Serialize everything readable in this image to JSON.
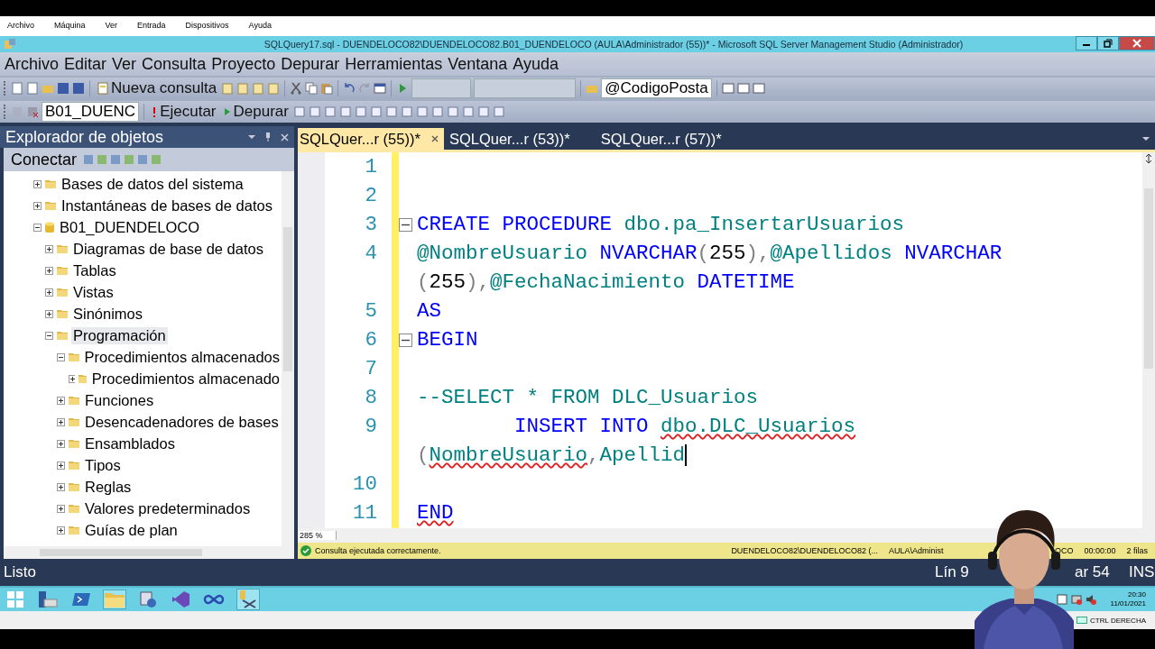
{
  "vm_menu": [
    "Archivo",
    "Máquina",
    "Ver",
    "Entrada",
    "Dispositivos",
    "Ayuda"
  ],
  "window": {
    "title": "SQLQuery17.sql - DUENDELOCO82\\DUENDELOCO82.B01_DUENDELOCO (AULA\\Administrador (55))* - Microsoft SQL Server Management Studio (Administrador)"
  },
  "menu": [
    "Archivo",
    "Editar",
    "Ver",
    "Consulta",
    "Proyecto",
    "Depurar",
    "Herramientas",
    "Ventana",
    "Ayuda"
  ],
  "toolbar1": {
    "new_query": "Nueva consulta",
    "param": "@CodigoPosta"
  },
  "toolbar2": {
    "database": "B01_DUENC",
    "execute": "Ejecutar",
    "debug": "Depurar"
  },
  "object_explorer": {
    "title": "Explorador de objetos",
    "connect": "Conectar",
    "tree": [
      {
        "label": "Bases de datos del sistema",
        "kind": "folder",
        "expanded": false,
        "selected": false
      },
      {
        "label": "Instantáneas de bases de datos",
        "kind": "folder",
        "expanded": false,
        "selected": false
      },
      {
        "label": "B01_DUENDELOCO",
        "kind": "database",
        "expanded": true,
        "selected": false,
        "children": [
          {
            "label": "Diagramas de base de datos",
            "kind": "folder",
            "expanded": false,
            "selected": false
          },
          {
            "label": "Tablas",
            "kind": "folder",
            "expanded": false,
            "selected": false
          },
          {
            "label": "Vistas",
            "kind": "folder",
            "expanded": false,
            "selected": false
          },
          {
            "label": "Sinónimos",
            "kind": "folder",
            "expanded": false,
            "selected": false
          },
          {
            "label": "Programación",
            "kind": "folder",
            "expanded": true,
            "selected": true,
            "children": [
              {
                "label": "Procedimientos almacenados",
                "kind": "folder",
                "expanded": true,
                "selected": false,
                "children": [
                  {
                    "label": "Procedimientos almacenado",
                    "kind": "folder",
                    "expanded": false,
                    "selected": false
                  }
                ]
              },
              {
                "label": "Funciones",
                "kind": "folder",
                "expanded": false,
                "selected": false
              },
              {
                "label": "Desencadenadores de bases",
                "kind": "folder",
                "expanded": false,
                "selected": false
              },
              {
                "label": "Ensamblados",
                "kind": "folder",
                "expanded": false,
                "selected": false
              },
              {
                "label": "Tipos",
                "kind": "folder",
                "expanded": false,
                "selected": false
              },
              {
                "label": "Reglas",
                "kind": "folder",
                "expanded": false,
                "selected": false
              },
              {
                "label": "Valores predeterminados",
                "kind": "folder",
                "expanded": false,
                "selected": false
              },
              {
                "label": "Guías de plan",
                "kind": "folder",
                "expanded": false,
                "selected": false
              }
            ]
          }
        ]
      }
    ]
  },
  "tabs": [
    {
      "label": "SQLQuer...r (55))*",
      "selected": true
    },
    {
      "label": "SQLQuer...r (53))*",
      "selected": false
    },
    {
      "label": "SQLQuer...r (57))*",
      "selected": false
    }
  ],
  "editor": {
    "lines": [
      {
        "number": "1",
        "fold": false
      },
      {
        "number": "2",
        "fold": false
      },
      {
        "number": "3",
        "fold": true,
        "rows": [
          {
            "tokens": [
              {
                "text": "CREATE PROCEDURE ",
                "kind": "keyword"
              },
              {
                "text": "dbo.pa_InsertarUsuarios",
                "kind": "ident"
              }
            ]
          }
        ]
      },
      {
        "number": "4",
        "fold": false,
        "rows": [
          {
            "tokens": [
              {
                "text": "@NombreUsuario",
                "kind": "ident"
              },
              {
                "text": " NVARCHAR",
                "kind": "keyword"
              },
              {
                "text": "(",
                "kind": "punct"
              },
              {
                "text": "255",
                "kind": "plain"
              },
              {
                "text": "),",
                "kind": "punct"
              },
              {
                "text": "@Apellidos",
                "kind": "ident"
              },
              {
                "text": " NVARCHAR",
                "kind": "keyword"
              }
            ]
          },
          {
            "tokens": [
              {
                "text": "(",
                "kind": "punct"
              },
              {
                "text": "255",
                "kind": "plain"
              },
              {
                "text": "),",
                "kind": "punct"
              },
              {
                "text": "@FechaNacimiento",
                "kind": "ident"
              },
              {
                "text": " DATETIME",
                "kind": "keyword"
              }
            ]
          }
        ]
      },
      {
        "number": "5",
        "fold": false,
        "rows": [
          {
            "tokens": [
              {
                "text": "AS",
                "kind": "keyword"
              }
            ]
          }
        ]
      },
      {
        "number": "6",
        "fold": true,
        "rows": [
          {
            "tokens": [
              {
                "text": "BEGIN",
                "kind": "keyword"
              }
            ]
          }
        ]
      },
      {
        "number": "7",
        "fold": false
      },
      {
        "number": "8",
        "fold": false,
        "rows": [
          {
            "tokens": [
              {
                "text": "--SELECT * FROM DLC_Usuarios",
                "kind": "comment"
              }
            ]
          }
        ]
      },
      {
        "number": "9",
        "fold": false,
        "rows": [
          {
            "tokens": [
              {
                "text": "        INSERT INTO ",
                "kind": "keyword"
              },
              {
                "text": "dbo.DLC_Usuarios",
                "kind": "ident",
                "error": true
              }
            ]
          },
          {
            "tokens": [
              {
                "text": "(",
                "kind": "punct"
              },
              {
                "text": "NombreUsuario",
                "kind": "ident",
                "error": true
              },
              {
                "text": ",",
                "kind": "punct"
              },
              {
                "text": "Apellid",
                "kind": "ident",
                "caret": true
              }
            ]
          }
        ]
      },
      {
        "number": "10",
        "fold": false
      },
      {
        "number": "11",
        "fold": false,
        "rows": [
          {
            "tokens": [
              {
                "text": "END",
                "kind": "keyword",
                "error": true
              }
            ]
          }
        ]
      }
    ],
    "zoom": "285 %"
  },
  "query_status": {
    "message": "Consulta ejecutada correctamente.",
    "server": "DUENDELOCO82\\DUENDELOCO82 (...",
    "user": "AULA\\Administ",
    "database": "OCO",
    "time": "00:00:00",
    "rows": "2 filas"
  },
  "status_bar": {
    "state": "Listo",
    "line": "Lín 9",
    "column": "ar 54",
    "mode": "INS"
  },
  "taskbar": {
    "time": "20:30",
    "date": "11/01/2021",
    "host_key": "CTRL DERECHA"
  }
}
